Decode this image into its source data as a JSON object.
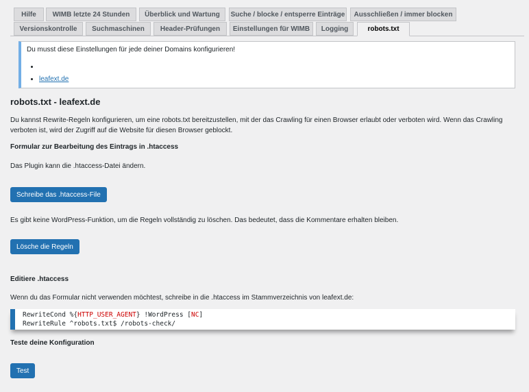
{
  "tabs_row1": [
    "Hilfe",
    "WIMB letzte 24 Stunden",
    "Überblick und Wartung",
    "Suche / blocke / entsperre Einträge",
    "Ausschließen / immer blocken"
  ],
  "tabs_row2": [
    "Versionskontrolle",
    "Suchmaschinen",
    "Header-Prüfungen",
    "Einstellungen für WIMB",
    "Logging",
    "robots.txt"
  ],
  "notice": {
    "text": "Du musst diese Einstellungen für jede deiner Domains konfigurieren!",
    "links": [
      "",
      "leafext.de"
    ]
  },
  "title": "robots.txt - leafext.de",
  "intro": "Du kannst Rewrite-Regeln konfigurieren, um eine robots.txt bereitzustellen, mit der das Crawling für einen Browser erlaubt oder verboten wird. Wenn das Crawling verboten ist, wird der Zugriff auf die Website für diesen Browser geblockt.",
  "form_heading": "Formular zur Bearbeitung des Eintrags in .htaccess",
  "plugin_text": "Das Plugin kann die .htaccess-Datei ändern.",
  "write_button": "Schreibe das .htaccess-File",
  "delete_text": "Es gibt keine WordPress-Funktion, um die Regeln vollständig zu löschen. Das bedeutet, dass die Kommentare erhalten bleiben.",
  "delete_button": "Lösche die Regeln",
  "edit_heading": "Editiere .htaccess",
  "edit_text": "Wenn du das Formular nicht verwenden möchtest, schreibe in die .htaccess im Stammverzeichnis von leafext.de:",
  "code": {
    "l1a": "RewriteCond ",
    "l1b": "%{",
    "l1c": "HTTP_USER_AGENT",
    "l1d": "}",
    " l1e": "",
    "l1f": " !WordPress ",
    "l1g": "[",
    "l1h": "NC",
    "l1i": "]",
    "l2a": "RewriteRule ",
    "l2b": "^",
    "l2c": "robots.txt$ ",
    "l2d": "/",
    "l2e": "robots-check",
    "l2f": "/"
  },
  "test_heading": "Teste deine Konfiguration",
  "test_button": "Test"
}
